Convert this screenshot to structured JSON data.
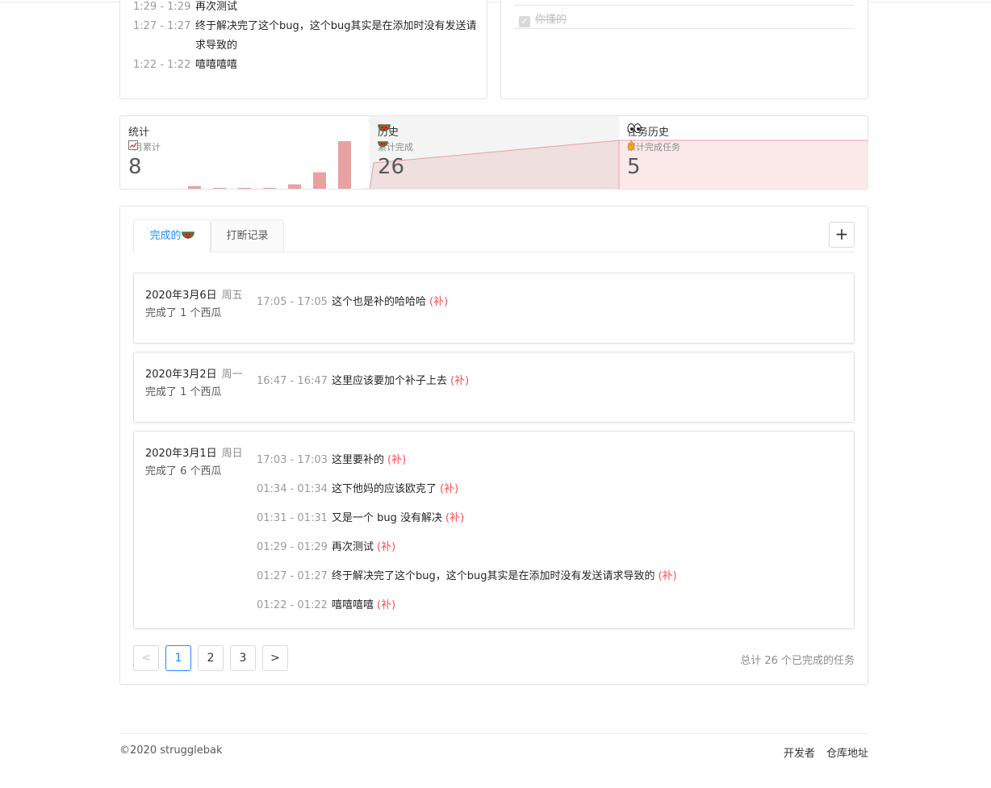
{
  "top_log": {
    "entries": [
      {
        "time": "1:29 - 1:29",
        "text": "再次测试"
      },
      {
        "time": "1:27 - 1:27",
        "text": "终于解决完了这个bug，这个bug其实是在添加时没有发送请求导致的"
      },
      {
        "time": "1:22 - 1:22",
        "text": "嘻嘻嘻嘻"
      }
    ]
  },
  "top_right": {
    "done_item": "你懂的"
  },
  "stats": {
    "s1": {
      "title": "统计",
      "sub": "3月累计",
      "num": "8",
      "bars": [
        0,
        1,
        0.5,
        0.5,
        0.5,
        1.5,
        5,
        14,
        0.3
      ]
    },
    "s2": {
      "title": "历史",
      "sub": "累计完成",
      "num": "26"
    },
    "s3": {
      "title": "任务",
      "title_suffix": "历史",
      "sub": "累计完成任务",
      "num": "5"
    }
  },
  "tabs": {
    "done": "完成的",
    "interrupt": "打断记录"
  },
  "add_button": "+",
  "days": [
    {
      "date": "2020年3月6日",
      "weekday": "周五",
      "count": "完成了 1 个西瓜",
      "entries": [
        {
          "time": "17:05 - 17:05",
          "text": "这个也是补的哈哈哈",
          "tag": "(补)"
        }
      ]
    },
    {
      "date": "2020年3月2日",
      "weekday": "周一",
      "count": "完成了 1 个西瓜",
      "entries": [
        {
          "time": "16:47 - 16:47",
          "text": "这里应该要加个补子上去",
          "tag": "(补)"
        }
      ]
    },
    {
      "date": "2020年3月1日",
      "weekday": "周日",
      "count": "完成了 6 个西瓜",
      "entries": [
        {
          "time": "17:03 - 17:03",
          "text": "这里要补的",
          "tag": "(补)"
        },
        {
          "time": "01:34 - 01:34",
          "text": "这下他妈的应该欧克了",
          "tag": "(补)"
        },
        {
          "time": "01:31 - 01:31",
          "text": "又是一个 bug 没有解决",
          "tag": "(补)"
        },
        {
          "time": "01:29 - 01:29",
          "text": "再次测试",
          "tag": "(补)"
        },
        {
          "time": "01:27 - 01:27",
          "text": "终于解决完了这个bug，这个bug其实是在添加时没有发送请求导致的",
          "tag": "(补)"
        },
        {
          "time": "01:22 - 01:22",
          "text": "嘻嘻嘻嘻",
          "tag": "(补)"
        }
      ]
    }
  ],
  "pagination": {
    "prev": "<",
    "pages": [
      "1",
      "2",
      "3"
    ],
    "next": ">",
    "current": "1",
    "total": "总计 26 个已完成的任务"
  },
  "footer": {
    "copyright": "©2020 strugglebak",
    "developer": "开发者",
    "repo": "仓库地址"
  },
  "colors": {
    "accent": "#1890ff",
    "tag": "#ff4d4f",
    "bar": "#e8a1a1",
    "area_fill": "#f3dede",
    "area_stroke": "#e9a2a2"
  }
}
